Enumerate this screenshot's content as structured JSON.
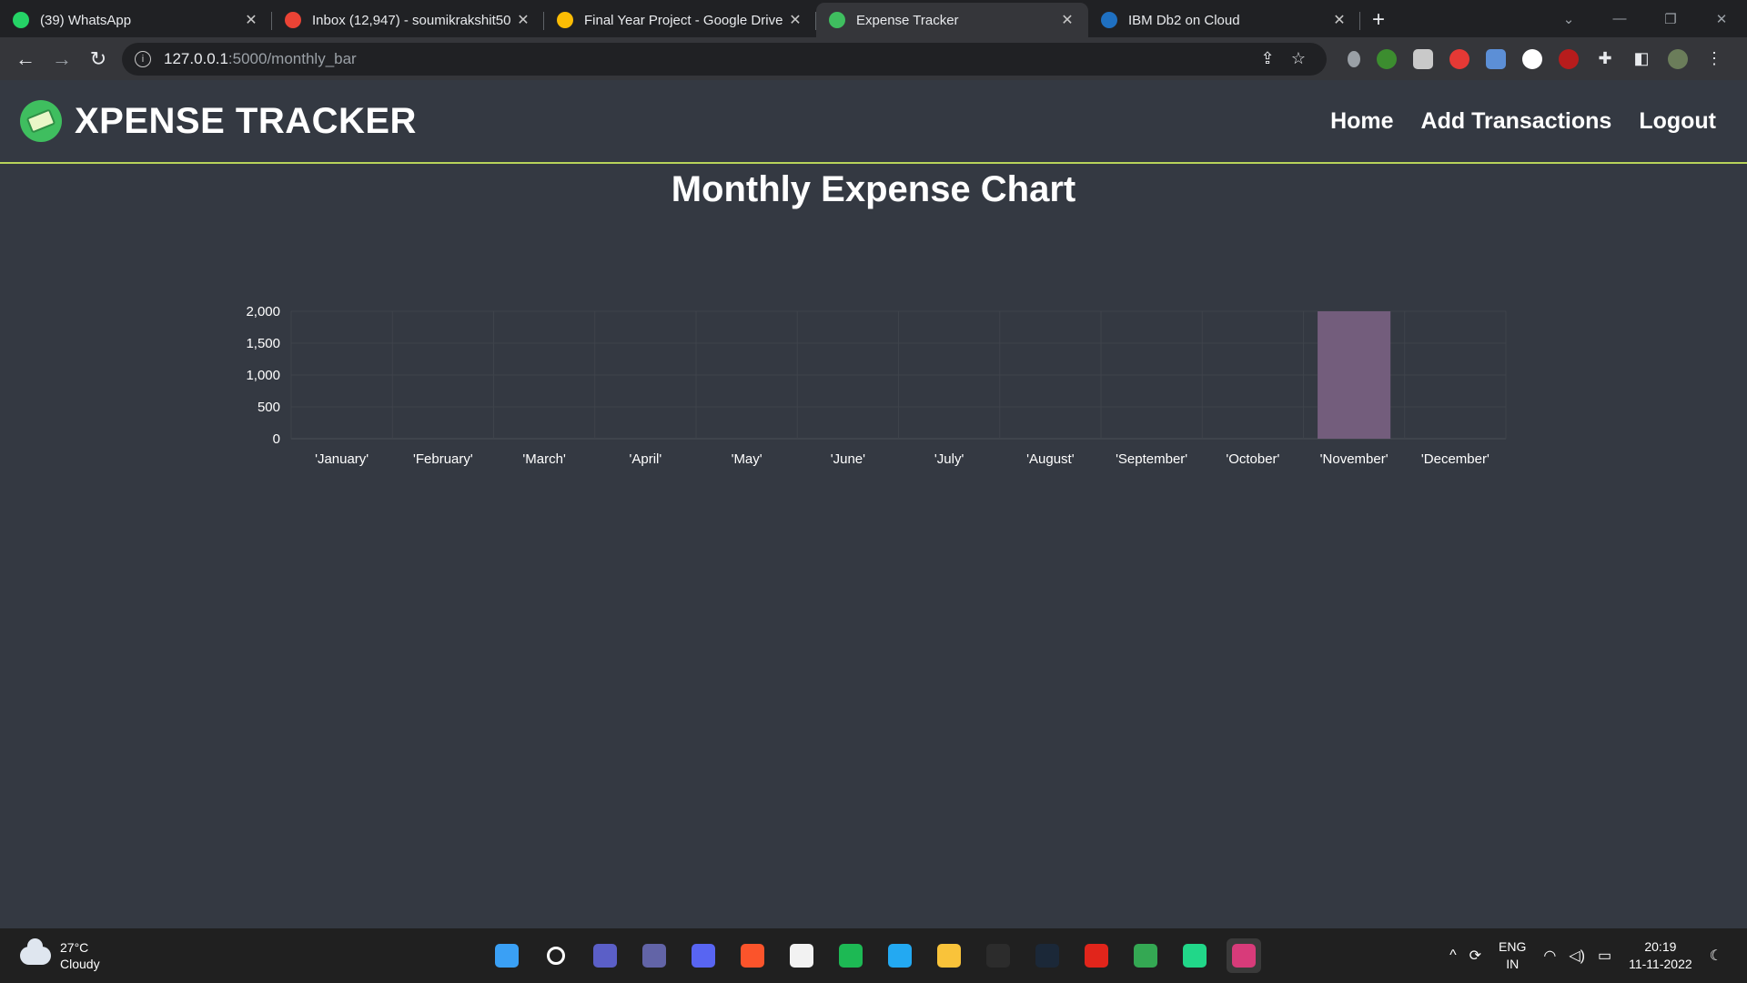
{
  "browser": {
    "tabs": [
      {
        "title": "(39) WhatsApp",
        "favicon": "whatsapp-icon",
        "color": "#25d366",
        "active": false
      },
      {
        "title": "Inbox (12,947) - soumikrakshit50",
        "favicon": "gmail-icon",
        "color": "#ea4335",
        "active": false
      },
      {
        "title": "Final Year Project - Google Drive",
        "favicon": "google-drive-icon",
        "color": "#fbbc04",
        "active": false
      },
      {
        "title": "Expense Tracker",
        "favicon": "xpense-tracker-icon",
        "color": "#3fbe5f",
        "active": true
      },
      {
        "title": "IBM Db2 on Cloud",
        "favicon": "ibm-db2-icon",
        "color": "#1f70c1",
        "active": false
      }
    ],
    "address": {
      "host": "127.0.0.1",
      "path": ":5000/monthly_bar"
    }
  },
  "app": {
    "brand": "XPENSE TRACKER",
    "nav": {
      "home": "Home",
      "add": "Add Transactions",
      "logout": "Logout"
    },
    "accent": "#b8d35a"
  },
  "page": {
    "title": "Monthly Expense Chart"
  },
  "chart_data": {
    "type": "bar",
    "categories": [
      "'January'",
      "'February'",
      "'March'",
      "'April'",
      "'May'",
      "'June'",
      "'July'",
      "'August'",
      "'September'",
      "'October'",
      "'November'",
      "'December'"
    ],
    "values": [
      0,
      0,
      0,
      0,
      0,
      0,
      0,
      0,
      0,
      0,
      2000,
      0
    ],
    "ylim": [
      0,
      2000
    ],
    "yticks": [
      0,
      500,
      1000,
      1500,
      2000
    ],
    "ytick_labels": [
      "0",
      "500",
      "1,000",
      "1,500",
      "2,000"
    ],
    "grid": true,
    "bar_color": "#735d7c"
  },
  "taskbar": {
    "weather": {
      "temp": "27°C",
      "condition": "Cloudy"
    },
    "apps": [
      {
        "name": "windows-start-icon",
        "color": "#3aa0f5"
      },
      {
        "name": "search-icon",
        "color": "#202020"
      },
      {
        "name": "meet-icon",
        "color": "#5b5fc7"
      },
      {
        "name": "teams-icon",
        "color": "#6264a7"
      },
      {
        "name": "discord-icon",
        "color": "#5865f2"
      },
      {
        "name": "brave-icon",
        "color": "#fb542b"
      },
      {
        "name": "microsoft-store-icon",
        "color": "#f2f2f2"
      },
      {
        "name": "spotify-icon",
        "color": "#1db954"
      },
      {
        "name": "vscode-icon",
        "color": "#23a9f2"
      },
      {
        "name": "file-explorer-icon",
        "color": "#f9c33a"
      },
      {
        "name": "terminal-icon",
        "color": "#2c2c2c"
      },
      {
        "name": "steam-icon",
        "color": "#1b2838"
      },
      {
        "name": "wps-office-icon",
        "color": "#e1251b"
      },
      {
        "name": "chrome-icon",
        "color": "#34a853"
      },
      {
        "name": "pycharm-icon",
        "color": "#21d789"
      },
      {
        "name": "snipping-tool-icon",
        "color": "#d83b7a"
      }
    ],
    "lang": {
      "line1": "ENG",
      "line2": "IN"
    },
    "clock": {
      "time": "20:19",
      "date": "11-11-2022"
    }
  }
}
